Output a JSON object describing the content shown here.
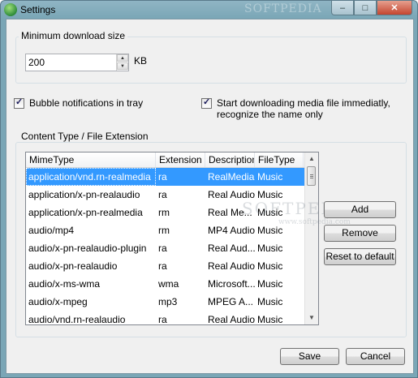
{
  "window": {
    "title": "Settings",
    "watermark_top": "SOFTPEDIA",
    "controls": {
      "minimize": "–",
      "maximize": "□",
      "close": "✕"
    }
  },
  "download_size": {
    "group_label": "Minimum download size",
    "value": "200",
    "unit": "KB"
  },
  "options": {
    "bubble_notifications": {
      "label": "Bubble notifications in tray",
      "checked": true
    },
    "start_downloading": {
      "label_line1": "Start downloading media file immediatly,",
      "label_line2": "recognize the name only",
      "checked": true
    }
  },
  "content_types": {
    "group_label": "Content Type / File Extension",
    "columns": [
      "MimeType",
      "Extension",
      "Description",
      "FileType"
    ],
    "rows": [
      [
        "application/vnd.rn-realmedia",
        "ra",
        "RealMedia",
        "Music"
      ],
      [
        "application/x-pn-realaudio",
        "ra",
        "Real Audio",
        "Music"
      ],
      [
        "application/x-pn-realmedia",
        "rm",
        "Real Me...",
        "Music"
      ],
      [
        "audio/mp4",
        "rm",
        "MP4 Audio",
        "Music"
      ],
      [
        "audio/x-pn-realaudio-plugin",
        "ra",
        "Real Aud...",
        "Music"
      ],
      [
        "audio/x-pn-realaudio",
        "ra",
        "Real Audio",
        "Music"
      ],
      [
        "audio/x-ms-wma",
        "wma",
        "Microsoft...",
        "Music"
      ],
      [
        "audio/x-mpeg",
        "mp3",
        "MPEG A...",
        "Music"
      ],
      [
        "audio/vnd.rn-realaudio",
        "ra",
        "Real Audio",
        "Music"
      ]
    ],
    "selected_row": 0
  },
  "buttons": {
    "add": "Add",
    "remove": "Remove",
    "reset": "Reset to default",
    "save": "Save",
    "cancel": "Cancel"
  },
  "watermark": {
    "main": "SOFTPEDIA",
    "sub": "www.softpedia.com"
  }
}
